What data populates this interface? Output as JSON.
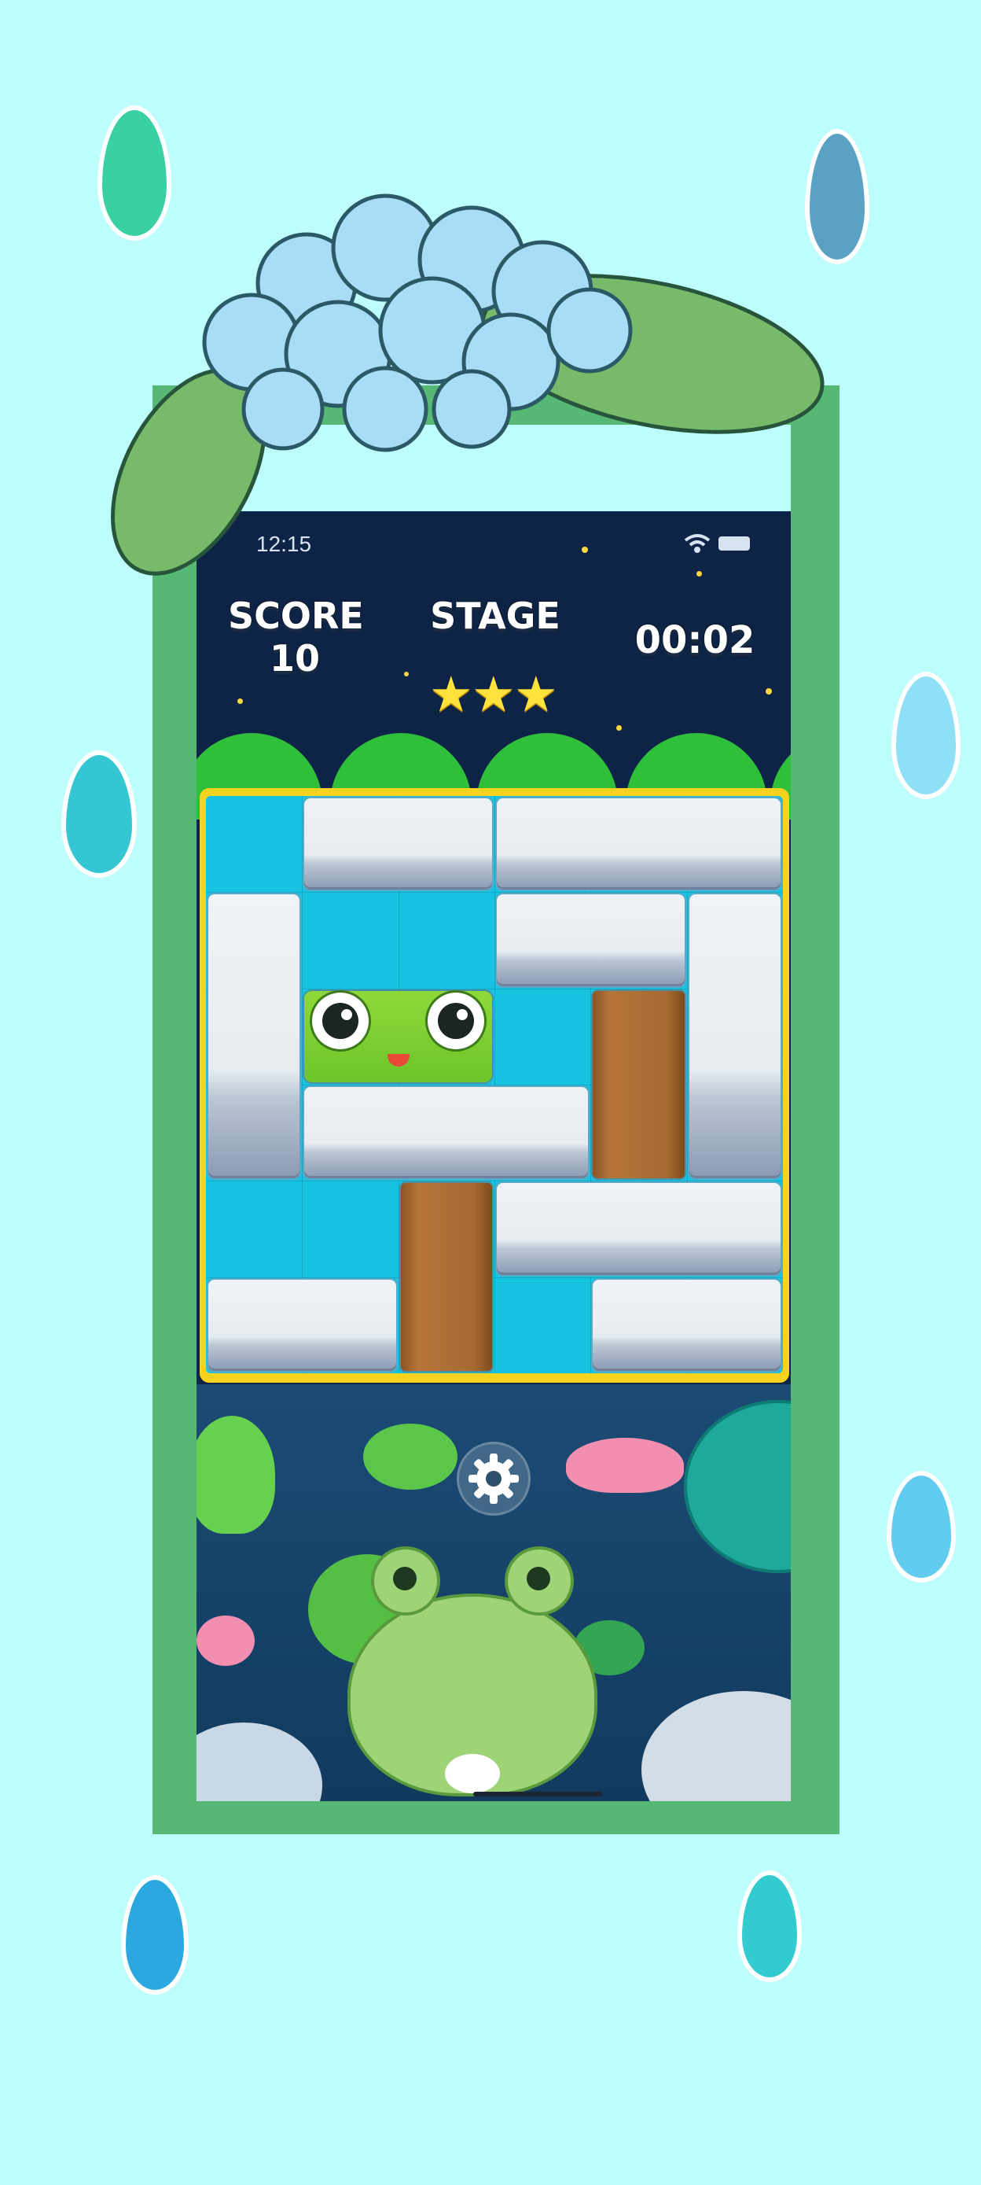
{
  "status_bar": {
    "time": "12:15"
  },
  "hud": {
    "score_label": "SCORE",
    "score_value": "10",
    "stage_label": "STAGE",
    "stars": [
      "★",
      "★",
      "★"
    ],
    "timer": "00:02"
  },
  "board": {
    "grid": 6,
    "blocks": [
      {
        "type": "stone",
        "row": 0,
        "col": 1,
        "w": 2,
        "h": 1
      },
      {
        "type": "stone",
        "row": 0,
        "col": 3,
        "w": 3,
        "h": 1
      },
      {
        "type": "stone",
        "row": 1,
        "col": 0,
        "w": 1,
        "h": 3
      },
      {
        "type": "stone",
        "row": 1,
        "col": 3,
        "w": 2,
        "h": 1
      },
      {
        "type": "stone",
        "row": 1,
        "col": 5,
        "w": 1,
        "h": 3
      },
      {
        "type": "frog",
        "row": 2,
        "col": 1,
        "w": 2,
        "h": 1
      },
      {
        "type": "wood",
        "row": 2,
        "col": 4,
        "w": 1,
        "h": 2
      },
      {
        "type": "stone",
        "row": 3,
        "col": 1,
        "w": 3,
        "h": 1
      },
      {
        "type": "wood",
        "row": 4,
        "col": 2,
        "w": 1,
        "h": 2
      },
      {
        "type": "stone",
        "row": 4,
        "col": 3,
        "w": 3,
        "h": 1
      },
      {
        "type": "stone",
        "row": 5,
        "col": 0,
        "w": 2,
        "h": 1
      },
      {
        "type": "stone",
        "row": 5,
        "col": 4,
        "w": 2,
        "h": 1
      }
    ]
  },
  "controls": {
    "settings_icon": "gear-icon"
  },
  "colors": {
    "background": "#bdfdfc",
    "frame": "#56b874",
    "board_border": "#f7d21e",
    "water": "#17c3e0"
  }
}
